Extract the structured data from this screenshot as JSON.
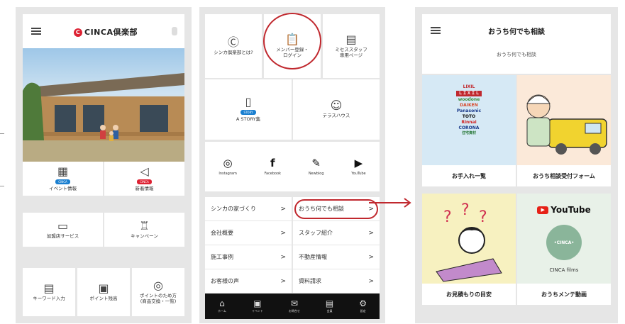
{
  "panel1": {
    "logo_mark": "C",
    "logo": "CINCA倶楽部",
    "tiles": [
      {
        "label": "イベント情報",
        "badge": "CINCA"
      },
      {
        "label": "新着情報",
        "badge": "CINCA"
      },
      {
        "label": "加盟店サービス"
      },
      {
        "label": "キャンペーン"
      },
      {
        "label": "キーワード入力"
      },
      {
        "label": "ポイント残高"
      },
      {
        "label": "ポイントのため方\n(商品交換・一覧)"
      }
    ]
  },
  "panel2": {
    "top_tiles": [
      {
        "label": "シンカ倶楽部とは?"
      },
      {
        "label": "メンバー登録・\nログイン"
      },
      {
        "label": "ミセススタッフ\n専用ページ"
      }
    ],
    "story": {
      "badge": "STORY",
      "label": "A STORY集"
    },
    "terrace": {
      "label": "テラスハウス"
    },
    "sns": [
      {
        "glyph": "◎",
        "label": "Instagram"
      },
      {
        "glyph": "f",
        "label": "Facebook"
      },
      {
        "glyph": "✎",
        "label": "Newblog"
      },
      {
        "glyph": "▶",
        "label": "YouTube"
      }
    ],
    "menu": [
      {
        "label": "シンカの家づくり",
        "arrow": ">"
      },
      {
        "label": "おうち何でも相談",
        "arrow": ">"
      },
      {
        "label": "会社概要",
        "arrow": ">"
      },
      {
        "label": "スタッフ紹介",
        "arrow": ">"
      },
      {
        "label": "施工事例",
        "arrow": ">"
      },
      {
        "label": "不動産情報",
        "arrow": ">"
      },
      {
        "label": "お客様の声",
        "arrow": ">"
      },
      {
        "label": "資料請求",
        "arrow": ">"
      }
    ],
    "bottom_nav": [
      {
        "glyph": "⌂",
        "label": "ホーム"
      },
      {
        "glyph": "▣",
        "label": "イベント"
      },
      {
        "glyph": "✉",
        "label": "お問合せ"
      },
      {
        "glyph": "▤",
        "label": "会員"
      },
      {
        "glyph": "⚙",
        "label": "設定"
      }
    ]
  },
  "panel3": {
    "title": "おうち何でも相談",
    "subtitle": "おうち何でも相談",
    "brands": [
      "LIXIL",
      "ＬＩＸＩＬ",
      "woodone",
      "DAIKEN",
      "Panasonic",
      "TOTO",
      "Rinnai",
      "CORONA",
      "住宅資材"
    ],
    "tiles": [
      {
        "caption": "お手入れ一覧"
      },
      {
        "caption": "おうち相談受付フォーム"
      },
      {
        "caption": "お見積もりの目安"
      },
      {
        "caption": "おうちメンテ動画"
      }
    ],
    "youtube_logo": "YouTube",
    "cinca_badge": "•CINCA•",
    "cinca_films": "CINCA films"
  },
  "colors": {
    "accent_red": "#c0282e",
    "youtube_red": "#e62117",
    "nav_black": "#111111",
    "panel_bg": "#e6e6e6"
  }
}
